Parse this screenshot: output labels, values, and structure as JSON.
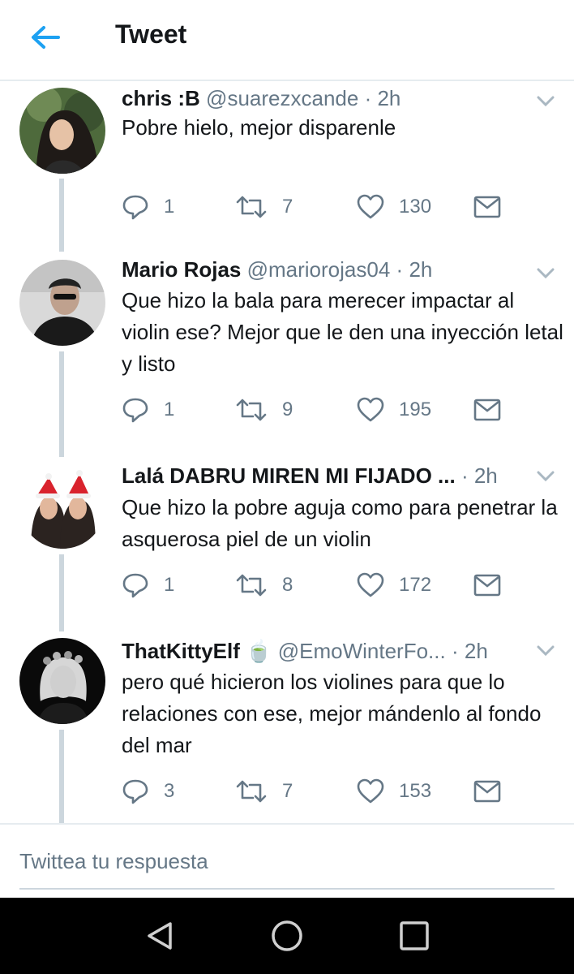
{
  "header": {
    "title": "Tweet",
    "back_icon": "arrow-left-icon",
    "accent": "#1da1f2"
  },
  "tweets": [
    {
      "name": "chris :B",
      "handle": "@suarezxcande",
      "time": "2h",
      "emoji": "",
      "text": "Pobre hielo, mejor disparenle",
      "replies": "1",
      "retweets": "7",
      "likes": "130"
    },
    {
      "name": "Mario Rojas",
      "handle": "@mariorojas04",
      "time": "2h",
      "emoji": "",
      "text": "Que hizo la bala para merecer impactar al violin ese? Mejor que le den una inyección letal y listo",
      "replies": "1",
      "retweets": "9",
      "likes": "195"
    },
    {
      "name": "Lalá DABRU MIREN MI FIJADO ...",
      "handle": "",
      "time": "2h",
      "emoji": "",
      "text": "Que hizo la pobre aguja como para penetrar la asquerosa piel de un violin",
      "replies": "1",
      "retweets": "8",
      "likes": "172"
    },
    {
      "name": "ThatKittyElf",
      "handle": "@EmoWinterFo...",
      "time": "2h",
      "emoji": "🍵",
      "text": "pero qué hicieron los violines para que lo relaciones con ese, mejor mándenlo al fondo del mar",
      "replies": "3",
      "retweets": "7",
      "likes": "153"
    }
  ],
  "reply_box": {
    "placeholder": "Twittea tu respuesta"
  },
  "navbar": {
    "back": "nav-back-icon",
    "home": "nav-home-icon",
    "recents": "nav-recents-icon"
  },
  "colors": {
    "secondary_text": "#657786",
    "thread_line": "#ccd6dd",
    "icon": "#657786"
  }
}
